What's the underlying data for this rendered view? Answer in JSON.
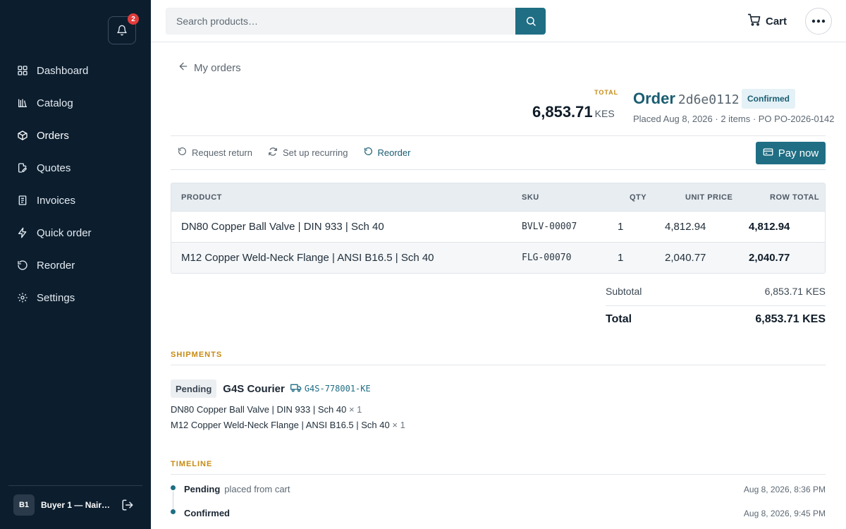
{
  "colors": {
    "sidebar_bg": "#0c1e2e",
    "accent": "#1f6e84",
    "accent_dark": "#1a5d72",
    "gold": "#c78a12",
    "badge_red": "#e23b3b"
  },
  "notifications": {
    "count": "2",
    "icon": "bell-icon"
  },
  "sidebar": {
    "items": [
      {
        "label": "Dashboard",
        "icon": "grid-icon"
      },
      {
        "label": "Catalog",
        "icon": "catalog-icon"
      },
      {
        "label": "Orders",
        "icon": "box-icon",
        "active": true
      },
      {
        "label": "Quotes",
        "icon": "quote-icon"
      },
      {
        "label": "Invoices",
        "icon": "invoice-icon"
      },
      {
        "label": "Quick order",
        "icon": "bolt-icon"
      },
      {
        "label": "Reorder",
        "icon": "reorder-icon"
      },
      {
        "label": "Settings",
        "icon": "gear-icon"
      }
    ],
    "user": {
      "initials": "B1",
      "name": "Buyer 1 — Nairobi"
    }
  },
  "topbar": {
    "search_placeholder": "Search products…",
    "cart_label": "Cart"
  },
  "order": {
    "back_label": "My orders",
    "total_label": "TOTAL",
    "total_amount": "6,853.71",
    "currency": "KES",
    "title": "Order",
    "id": "2d6e0112",
    "status": "Confirmed",
    "meta": "Placed Aug 8, 2026 · 2 items · PO PO-2026-0142"
  },
  "actions": {
    "request_return": "Request return",
    "recurring": "Set up recurring",
    "reorder": "Reorder",
    "pay_now": "Pay now"
  },
  "table": {
    "headers": {
      "product": "PRODUCT",
      "sku": "SKU",
      "qty": "QTY",
      "unit_price": "UNIT PRICE",
      "row_total": "ROW TOTAL"
    },
    "rows": [
      {
        "product": "DN80 Copper Ball Valve | DIN 933 | Sch 40",
        "sku": "BVLV-00007",
        "qty": "1",
        "unit_price": "4,812.94",
        "row_total": "4,812.94"
      },
      {
        "product": "M12 Copper Weld-Neck Flange | ANSI B16.5 | Sch 40",
        "sku": "FLG-00070",
        "qty": "1",
        "unit_price": "2,040.77",
        "row_total": "2,040.77"
      }
    ]
  },
  "summary": {
    "subtotal_label": "Subtotal",
    "subtotal_value": "6,853.71 KES",
    "total_label": "Total",
    "total_value": "6,853.71 KES"
  },
  "shipments": {
    "title": "SHIPMENTS",
    "status": "Pending",
    "courier": "G4S Courier",
    "tracking": "G4S-778001-KE",
    "items": [
      {
        "name": "DN80 Copper Ball Valve | DIN 933 | Sch 40",
        "qty": "× 1"
      },
      {
        "name": "M12 Copper Weld-Neck Flange | ANSI B16.5 | Sch 40",
        "qty": "× 1"
      }
    ]
  },
  "timeline": {
    "title": "TIMELINE",
    "events": [
      {
        "status": "Pending",
        "note": "placed from cart",
        "time": "Aug 8, 2026, 8:36 PM"
      },
      {
        "status": "Confirmed",
        "note": "",
        "time": "Aug 8, 2026, 9:45 PM"
      }
    ]
  }
}
